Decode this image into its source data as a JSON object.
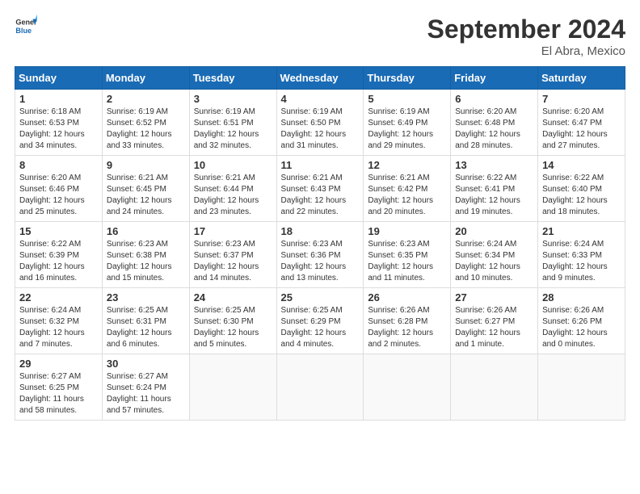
{
  "header": {
    "logo_line1": "General",
    "logo_line2": "Blue",
    "month": "September 2024",
    "location": "El Abra, Mexico"
  },
  "weekdays": [
    "Sunday",
    "Monday",
    "Tuesday",
    "Wednesday",
    "Thursday",
    "Friday",
    "Saturday"
  ],
  "weeks": [
    [
      {
        "day": "1",
        "info": "Sunrise: 6:18 AM\nSunset: 6:53 PM\nDaylight: 12 hours\nand 34 minutes."
      },
      {
        "day": "2",
        "info": "Sunrise: 6:19 AM\nSunset: 6:52 PM\nDaylight: 12 hours\nand 33 minutes."
      },
      {
        "day": "3",
        "info": "Sunrise: 6:19 AM\nSunset: 6:51 PM\nDaylight: 12 hours\nand 32 minutes."
      },
      {
        "day": "4",
        "info": "Sunrise: 6:19 AM\nSunset: 6:50 PM\nDaylight: 12 hours\nand 31 minutes."
      },
      {
        "day": "5",
        "info": "Sunrise: 6:19 AM\nSunset: 6:49 PM\nDaylight: 12 hours\nand 29 minutes."
      },
      {
        "day": "6",
        "info": "Sunrise: 6:20 AM\nSunset: 6:48 PM\nDaylight: 12 hours\nand 28 minutes."
      },
      {
        "day": "7",
        "info": "Sunrise: 6:20 AM\nSunset: 6:47 PM\nDaylight: 12 hours\nand 27 minutes."
      }
    ],
    [
      {
        "day": "8",
        "info": "Sunrise: 6:20 AM\nSunset: 6:46 PM\nDaylight: 12 hours\nand 25 minutes."
      },
      {
        "day": "9",
        "info": "Sunrise: 6:21 AM\nSunset: 6:45 PM\nDaylight: 12 hours\nand 24 minutes."
      },
      {
        "day": "10",
        "info": "Sunrise: 6:21 AM\nSunset: 6:44 PM\nDaylight: 12 hours\nand 23 minutes."
      },
      {
        "day": "11",
        "info": "Sunrise: 6:21 AM\nSunset: 6:43 PM\nDaylight: 12 hours\nand 22 minutes."
      },
      {
        "day": "12",
        "info": "Sunrise: 6:21 AM\nSunset: 6:42 PM\nDaylight: 12 hours\nand 20 minutes."
      },
      {
        "day": "13",
        "info": "Sunrise: 6:22 AM\nSunset: 6:41 PM\nDaylight: 12 hours\nand 19 minutes."
      },
      {
        "day": "14",
        "info": "Sunrise: 6:22 AM\nSunset: 6:40 PM\nDaylight: 12 hours\nand 18 minutes."
      }
    ],
    [
      {
        "day": "15",
        "info": "Sunrise: 6:22 AM\nSunset: 6:39 PM\nDaylight: 12 hours\nand 16 minutes."
      },
      {
        "day": "16",
        "info": "Sunrise: 6:23 AM\nSunset: 6:38 PM\nDaylight: 12 hours\nand 15 minutes."
      },
      {
        "day": "17",
        "info": "Sunrise: 6:23 AM\nSunset: 6:37 PM\nDaylight: 12 hours\nand 14 minutes."
      },
      {
        "day": "18",
        "info": "Sunrise: 6:23 AM\nSunset: 6:36 PM\nDaylight: 12 hours\nand 13 minutes."
      },
      {
        "day": "19",
        "info": "Sunrise: 6:23 AM\nSunset: 6:35 PM\nDaylight: 12 hours\nand 11 minutes."
      },
      {
        "day": "20",
        "info": "Sunrise: 6:24 AM\nSunset: 6:34 PM\nDaylight: 12 hours\nand 10 minutes."
      },
      {
        "day": "21",
        "info": "Sunrise: 6:24 AM\nSunset: 6:33 PM\nDaylight: 12 hours\nand 9 minutes."
      }
    ],
    [
      {
        "day": "22",
        "info": "Sunrise: 6:24 AM\nSunset: 6:32 PM\nDaylight: 12 hours\nand 7 minutes."
      },
      {
        "day": "23",
        "info": "Sunrise: 6:25 AM\nSunset: 6:31 PM\nDaylight: 12 hours\nand 6 minutes."
      },
      {
        "day": "24",
        "info": "Sunrise: 6:25 AM\nSunset: 6:30 PM\nDaylight: 12 hours\nand 5 minutes."
      },
      {
        "day": "25",
        "info": "Sunrise: 6:25 AM\nSunset: 6:29 PM\nDaylight: 12 hours\nand 4 minutes."
      },
      {
        "day": "26",
        "info": "Sunrise: 6:26 AM\nSunset: 6:28 PM\nDaylight: 12 hours\nand 2 minutes."
      },
      {
        "day": "27",
        "info": "Sunrise: 6:26 AM\nSunset: 6:27 PM\nDaylight: 12 hours\nand 1 minute."
      },
      {
        "day": "28",
        "info": "Sunrise: 6:26 AM\nSunset: 6:26 PM\nDaylight: 12 hours\nand 0 minutes."
      }
    ],
    [
      {
        "day": "29",
        "info": "Sunrise: 6:27 AM\nSunset: 6:25 PM\nDaylight: 11 hours\nand 58 minutes."
      },
      {
        "day": "30",
        "info": "Sunrise: 6:27 AM\nSunset: 6:24 PM\nDaylight: 11 hours\nand 57 minutes."
      },
      null,
      null,
      null,
      null,
      null
    ]
  ]
}
